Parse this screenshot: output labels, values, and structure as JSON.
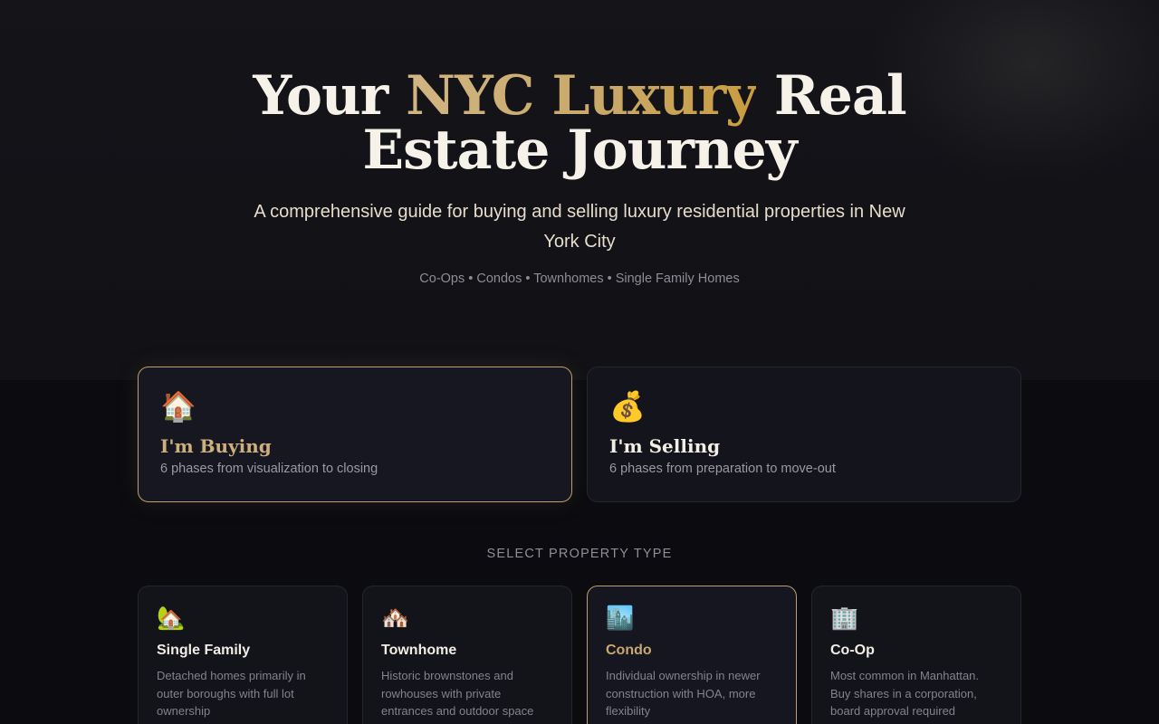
{
  "hero": {
    "title_prefix": "Your ",
    "title_accent": "NYC Luxury",
    "title_suffix_line1": " Real",
    "title_line2": "Estate Journey",
    "subtitle": "A comprehensive guide for buying and selling luxury residential properties in New York City",
    "property_types_line": "Co-Ops • Condos • Townhomes • Single Family Homes"
  },
  "modes": [
    {
      "icon": "🏠",
      "icon_name": "house-icon",
      "title": "I'm Buying",
      "description": "6 phases from visualization to closing",
      "active": true
    },
    {
      "icon": "💰",
      "icon_name": "money-bag-icon",
      "title": "I'm Selling",
      "description": "6 phases from preparation to move-out",
      "active": false
    }
  ],
  "section_label": "SELECT PROPERTY TYPE",
  "property_types": [
    {
      "icon": "🏡",
      "icon_name": "house-with-garden-icon",
      "title": "Single Family",
      "description": "Detached homes primarily in outer boroughs with full lot ownership",
      "active": false
    },
    {
      "icon": "🏘️",
      "icon_name": "houses-icon",
      "title": "Townhome",
      "description": "Historic brownstones and rowhouses with private entrances and outdoor space",
      "active": false
    },
    {
      "icon": "🏙️",
      "icon_name": "cityscape-icon",
      "title": "Condo",
      "description": "Individual ownership in newer construction with HOA, more flexibility",
      "active": true
    },
    {
      "icon": "🏢",
      "icon_name": "office-building-icon",
      "title": "Co-Op",
      "description": "Most common in Manhattan. Buy shares in a corporation, board approval required",
      "active": false
    }
  ],
  "colors": {
    "accent_gold": "#c9a766",
    "background": "#0b0b10",
    "card_bg": "#14141c",
    "card_border": "#25252e"
  }
}
